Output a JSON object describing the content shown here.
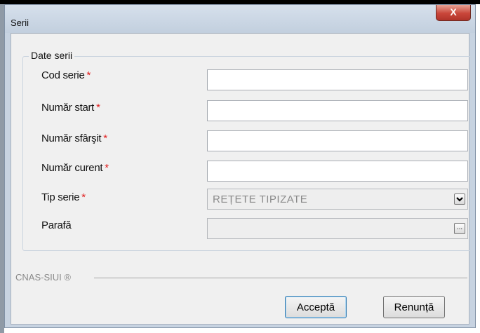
{
  "window": {
    "title": "Serii",
    "close_label": "X"
  },
  "group": {
    "legend": "Date serii"
  },
  "fields": [
    {
      "label": "Cod serie",
      "required_mark": "*",
      "value": ""
    },
    {
      "label": "Număr start",
      "required_mark": "*",
      "value": ""
    },
    {
      "label": "Număr sfârşit",
      "required_mark": "*",
      "value": ""
    },
    {
      "label": "Număr curent",
      "required_mark": "*",
      "value": ""
    }
  ],
  "tip_serie": {
    "label": "Tip serie",
    "required_mark": "*",
    "selected": "REȚETE TIPIZATE",
    "dropdown_icon": "chevron-down-icon"
  },
  "parafa": {
    "label": "Parafă",
    "value": "",
    "browse_label": "..."
  },
  "footer": {
    "brand": "CNAS-SIUI ®"
  },
  "buttons": {
    "accept": "Acceptă",
    "cancel": "Renunță"
  },
  "colors": {
    "required": "#e02020",
    "close_button": "#c9463a",
    "window_frame": "#c7d3e1",
    "client_bg": "#f0f0f0"
  }
}
